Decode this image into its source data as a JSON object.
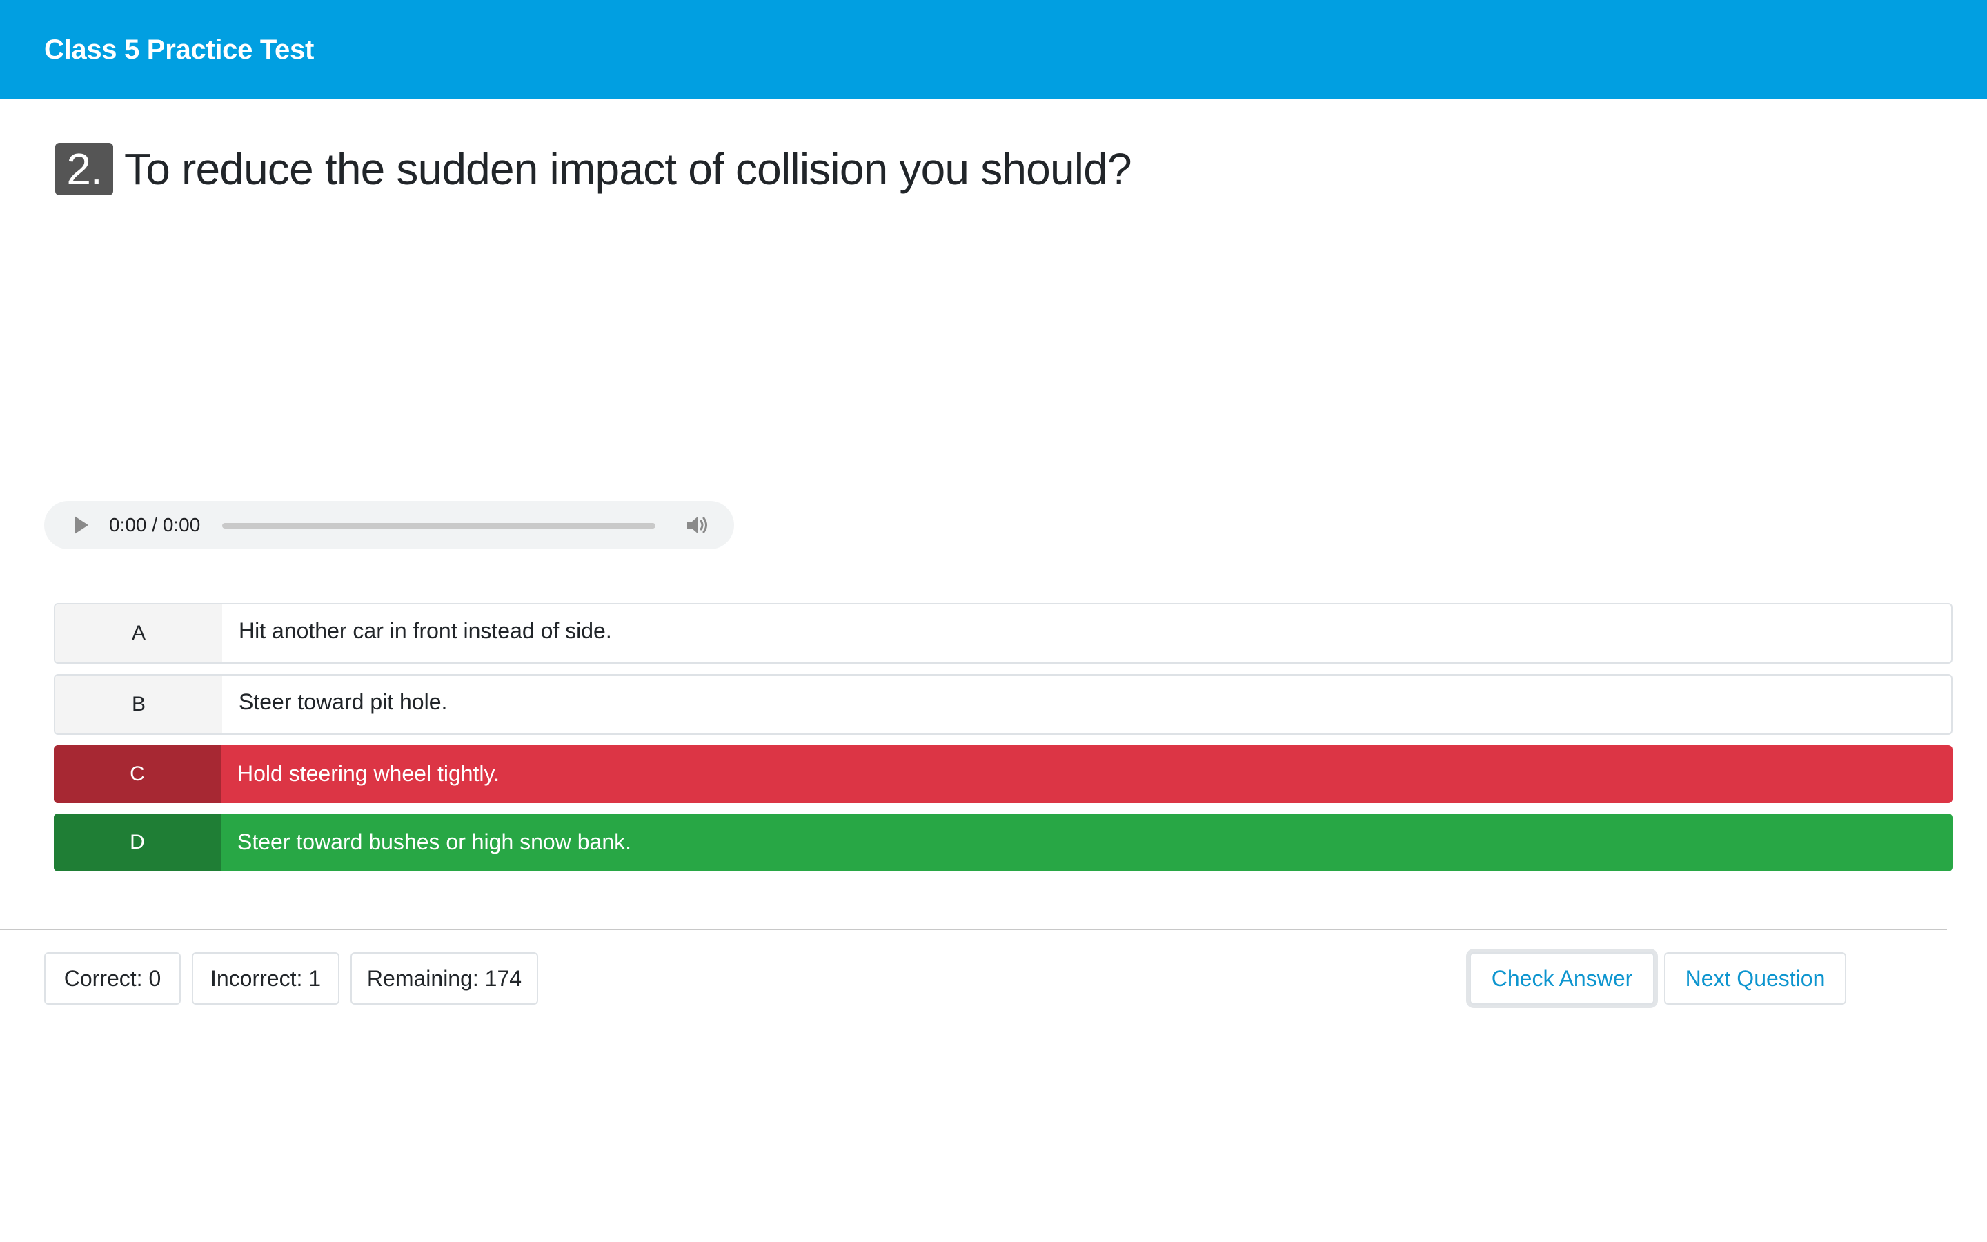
{
  "header": {
    "title": "Class 5 Practice Test"
  },
  "question": {
    "number": "2.",
    "text": "To reduce the sudden impact of collision you should?"
  },
  "audio": {
    "time": "0:00 / 0:00"
  },
  "options": [
    {
      "letter": "A",
      "text": "Hit another car in front instead of side.",
      "state": "neutral"
    },
    {
      "letter": "B",
      "text": "Steer toward pit hole.",
      "state": "neutral"
    },
    {
      "letter": "C",
      "text": "Hold steering wheel tightly.",
      "state": "incorrect"
    },
    {
      "letter": "D",
      "text": "Steer toward bushes or high snow bank.",
      "state": "correct"
    }
  ],
  "stats": {
    "correct": "Correct: 0",
    "incorrect": "Incorrect: 1",
    "remaining": "Remaining: 174"
  },
  "actions": {
    "check_answer": "Check Answer",
    "next_question": "Next Question"
  },
  "colors": {
    "header_bg": "#019fe1",
    "incorrect": "#dc3545",
    "correct": "#28a745",
    "link": "#0d95cf"
  },
  "icons": {
    "play": "play-icon",
    "volume": "volume-icon"
  }
}
